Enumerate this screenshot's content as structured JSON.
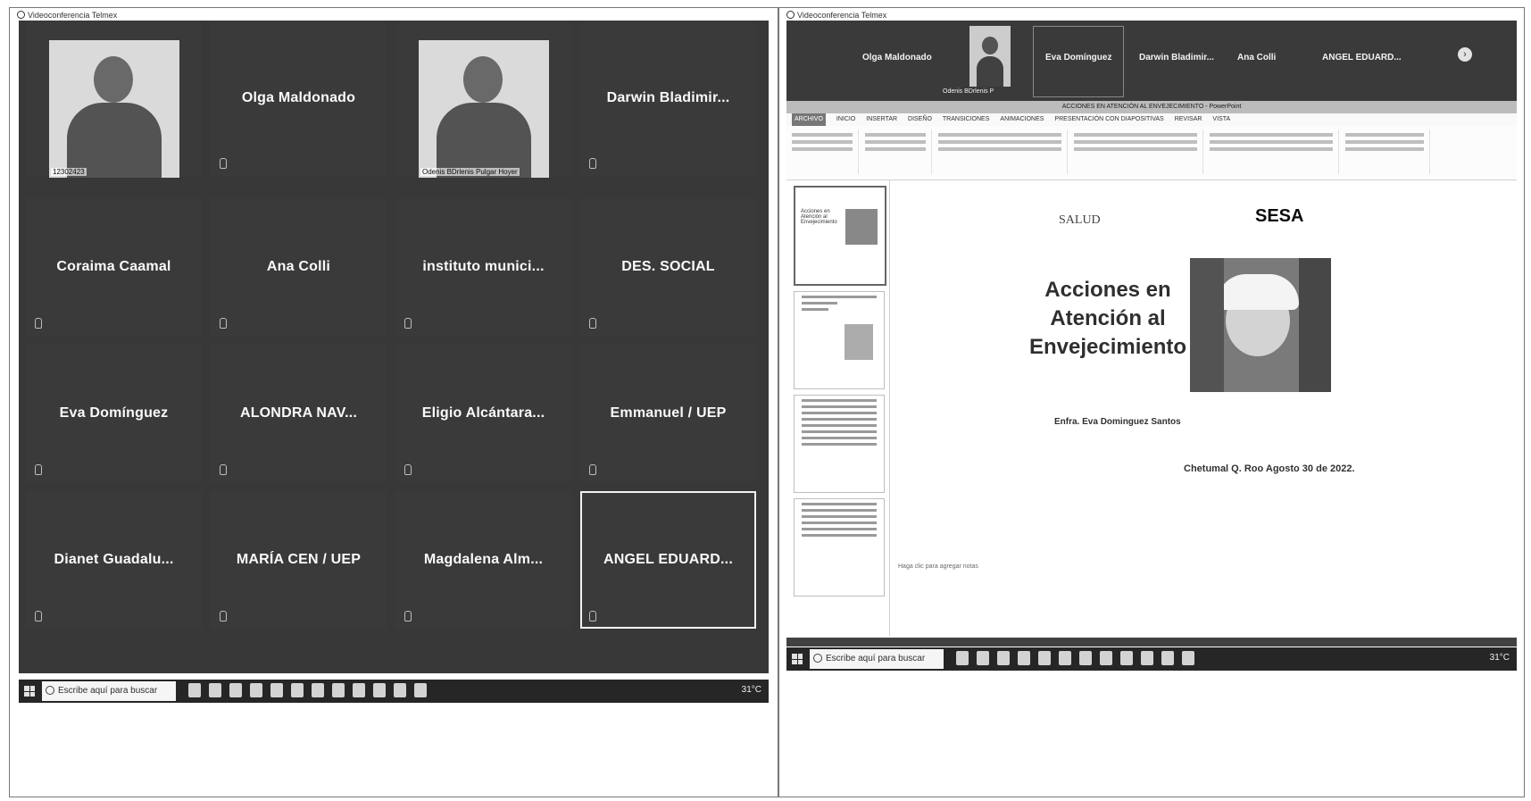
{
  "left": {
    "window_title": "Videoconferencia Telmex",
    "tiles": [
      {
        "name": "",
        "video": true,
        "caption": "12302423"
      },
      {
        "name": "Olga Maldonado"
      },
      {
        "name": "",
        "video": true,
        "caption": "Odenis BDrlenis Pulgar Hoyer"
      },
      {
        "name": "Darwin Bladimir..."
      },
      {
        "name": "Coraima Caamal"
      },
      {
        "name": "Ana Colli"
      },
      {
        "name": "instituto munici..."
      },
      {
        "name": "DES. SOCIAL"
      },
      {
        "name": "Eva Domínguez"
      },
      {
        "name": "ALONDRA NAV..."
      },
      {
        "name": "Eligio Alcántara..."
      },
      {
        "name": "Emmanuel / UEP"
      },
      {
        "name": "Dianet Guadalu..."
      },
      {
        "name": "MARÍA CEN / UEP"
      },
      {
        "name": "Magdalena Alm..."
      },
      {
        "name": "ANGEL EDUARD...",
        "active": true
      }
    ],
    "taskbar": {
      "search_placeholder": "Escribe aquí para buscar",
      "temp": "31°C"
    }
  },
  "right": {
    "window_title": "Videoconferencia Telmex",
    "strip": {
      "names": [
        "Olga Maldonado",
        "Eva Domínguez",
        "Darwin Bladimir...",
        "Ana Colli",
        "ANGEL EDUARD..."
      ],
      "video_caption": "Odenis BDrlenis P"
    },
    "ppt": {
      "titlebar": "ACCIONES EN ATENCIÓN AL ENVEJECIMIENTO - PowerPoint",
      "tabs": [
        "ARCHIVO",
        "INICIO",
        "INSERTAR",
        "DISEÑO",
        "TRANSICIONES",
        "ANIMACIONES",
        "PRESENTACIÓN CON DIAPOSITIVAS",
        "REVISAR",
        "VISTA"
      ],
      "notes_placeholder": "Haga clic para agregar notas"
    },
    "slide": {
      "logo_left": "SALUD",
      "logo_right": "SESA",
      "title": "Acciones en Atención al Envejecimiento",
      "author": "Enfra. Eva Dominguez Santos",
      "date": "Chetumal Q. Roo Agosto 30 de 2022."
    },
    "thumbs": [
      {
        "title": "Acciones en Atención al Envejecimiento"
      },
      {
        "title": ""
      },
      {
        "title": ""
      },
      {
        "title": ""
      }
    ],
    "taskbar": {
      "search_placeholder": "Escribe aquí para buscar",
      "temp": "31°C"
    }
  }
}
